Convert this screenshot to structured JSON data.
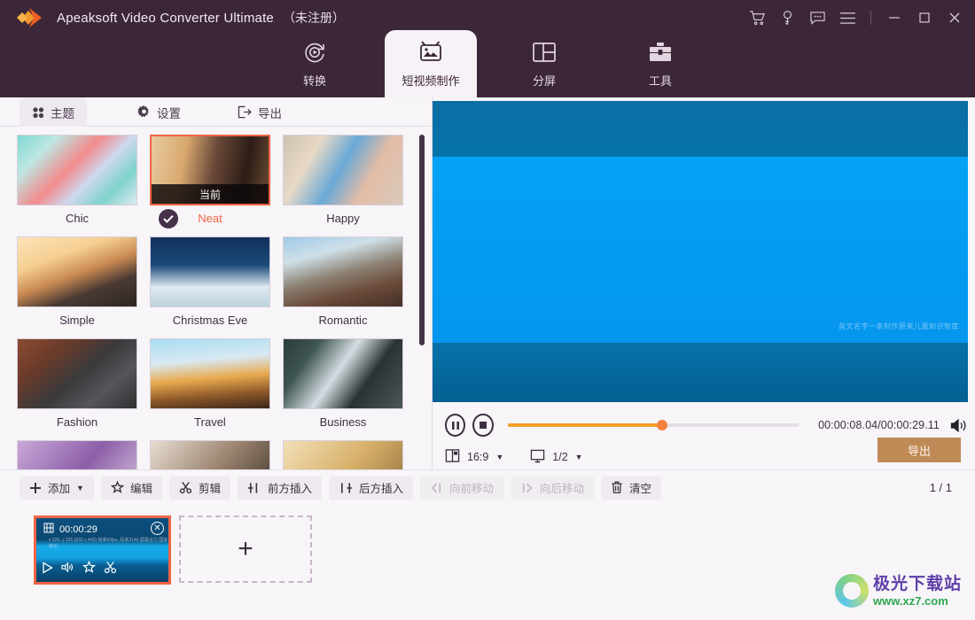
{
  "window": {
    "app_title": "Apeaksoft Video Converter Ultimate",
    "registration_status": "（未注册）",
    "logo_icon": "apeaksoft-diamond-logo",
    "controls": [
      {
        "name": "cart-icon",
        "label": "购物车"
      },
      {
        "name": "key-icon",
        "label": "注册"
      },
      {
        "name": "feedback-icon",
        "label": "反馈"
      },
      {
        "name": "menu-icon",
        "label": "菜单"
      },
      {
        "name": "minimize-icon",
        "label": "最小化"
      },
      {
        "name": "maximize-icon",
        "label": "最大化"
      },
      {
        "name": "close-icon",
        "label": "关闭"
      }
    ]
  },
  "nav": {
    "tabs": [
      {
        "label": "转换",
        "icon": "convert-icon",
        "active": false
      },
      {
        "label": "短视频制作",
        "icon": "mv-icon",
        "active": true
      },
      {
        "label": "分屏",
        "icon": "collage-icon",
        "active": false
      },
      {
        "label": "工具",
        "icon": "toolbox-icon",
        "active": false
      }
    ]
  },
  "subtabs": [
    {
      "label": "主题",
      "icon": "grid-icon",
      "active": true
    },
    {
      "label": "设置",
      "icon": "gear-icon",
      "active": false
    },
    {
      "label": "导出",
      "icon": "export-icon",
      "active": false
    }
  ],
  "themes": {
    "current_badge": "当前",
    "items": [
      {
        "name": "Chic",
        "selected": false
      },
      {
        "name": "Neat",
        "selected": true
      },
      {
        "name": "Happy",
        "selected": false
      },
      {
        "name": "Simple",
        "selected": false
      },
      {
        "name": "Christmas Eve",
        "selected": false
      },
      {
        "name": "Romantic",
        "selected": false
      },
      {
        "name": "Fashion",
        "selected": false
      },
      {
        "name": "Travel",
        "selected": false
      },
      {
        "name": "Business",
        "selected": false
      }
    ]
  },
  "preview": {
    "watermark_text": "英文名字一条制作原来儿童知识智库",
    "pause_icon": "pause-icon",
    "stop_icon": "stop-icon",
    "volume_icon": "volume-icon",
    "progress_percent": 45,
    "time_display": "00:00:08.04/00:00:29.11",
    "aspect_ratio": {
      "icon": "aspect-ratio-icon",
      "value": "16:9"
    },
    "screen_size": {
      "icon": "monitor-icon",
      "value": "1/2"
    },
    "export_button": "导出"
  },
  "toolbar": {
    "buttons": [
      {
        "label": "添加",
        "icon": "plus-icon",
        "dropdown": true,
        "disabled": false
      },
      {
        "label": "编辑",
        "icon": "edit-star-icon",
        "dropdown": false,
        "disabled": false
      },
      {
        "label": "剪辑",
        "icon": "scissors-icon",
        "dropdown": false,
        "disabled": false
      },
      {
        "label": "前方插入",
        "icon": "insert-before-icon",
        "dropdown": false,
        "disabled": false
      },
      {
        "label": "后方插入",
        "icon": "insert-after-icon",
        "dropdown": false,
        "disabled": false
      },
      {
        "label": "向前移动",
        "icon": "move-left-icon",
        "dropdown": false,
        "disabled": true
      },
      {
        "label": "向后移动",
        "icon": "move-right-icon",
        "dropdown": false,
        "disabled": true
      },
      {
        "label": "清空",
        "icon": "trash-icon",
        "dropdown": false,
        "disabled": false
      }
    ],
    "page_indicator": "1 / 1"
  },
  "timeline": {
    "clip": {
      "duration": "00:00:29",
      "film_icon": "film-icon",
      "close_icon": "close-circle-icon",
      "overlay_text": "x 526, y 235 (932 x 442)\n帧率60fps, 码率3140\n屏幕合力 国家知识",
      "tools": [
        "play-icon",
        "volume-icon",
        "edit-star-icon",
        "scissors-icon"
      ]
    },
    "add_slot": {
      "icon": "plus-icon"
    }
  },
  "site_watermark": {
    "name": "极光下载站",
    "url": "www.xz7.com",
    "logo_icon": "aurora-g-logo"
  },
  "colors": {
    "titlebar": "#3c2739",
    "accent_orange": "#f06445",
    "panel_bg": "#f7f5f8",
    "export_button": "#c08a56",
    "progress": "#f5a12a"
  }
}
